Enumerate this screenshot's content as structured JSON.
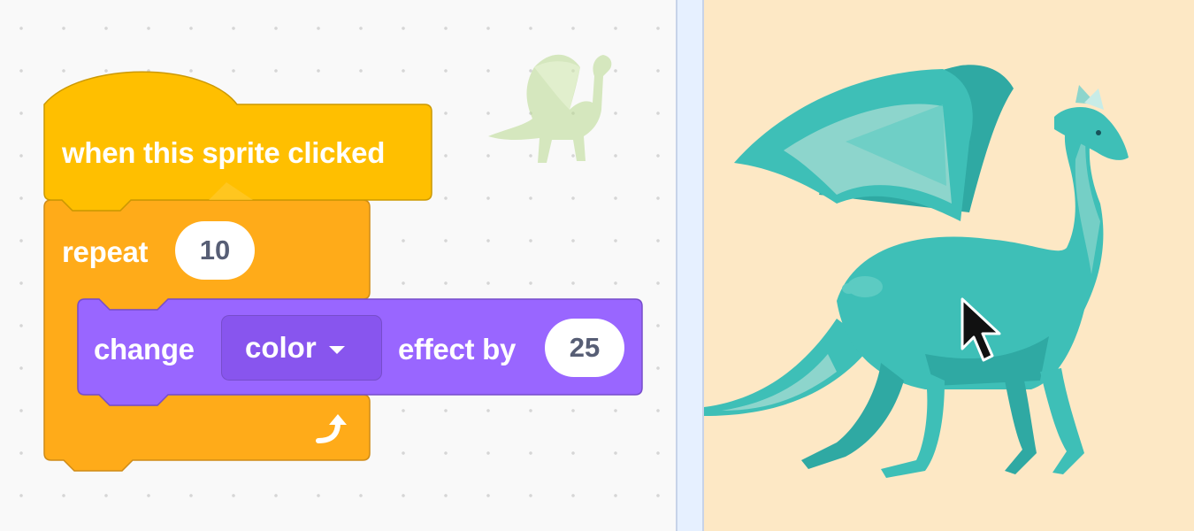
{
  "editor": {
    "hat_block": {
      "text": "when this sprite clicked",
      "category": "events",
      "color": "#ffbf00"
    },
    "repeat_block": {
      "label": "repeat",
      "count": "10",
      "category": "control",
      "color": "#ffab19"
    },
    "effect_block": {
      "change_label": "change",
      "effect_option": "color",
      "by_label": "effect by",
      "amount": "25",
      "category": "looks",
      "color": "#9966ff"
    },
    "sprite_thumbnail_icon": "dragon-icon"
  },
  "stage": {
    "background_color": "#fde8c5",
    "sprite_icon": "dragon-icon",
    "sprite_color": "#3ebfb7",
    "cursor_icon": "arrow-cursor-icon"
  }
}
